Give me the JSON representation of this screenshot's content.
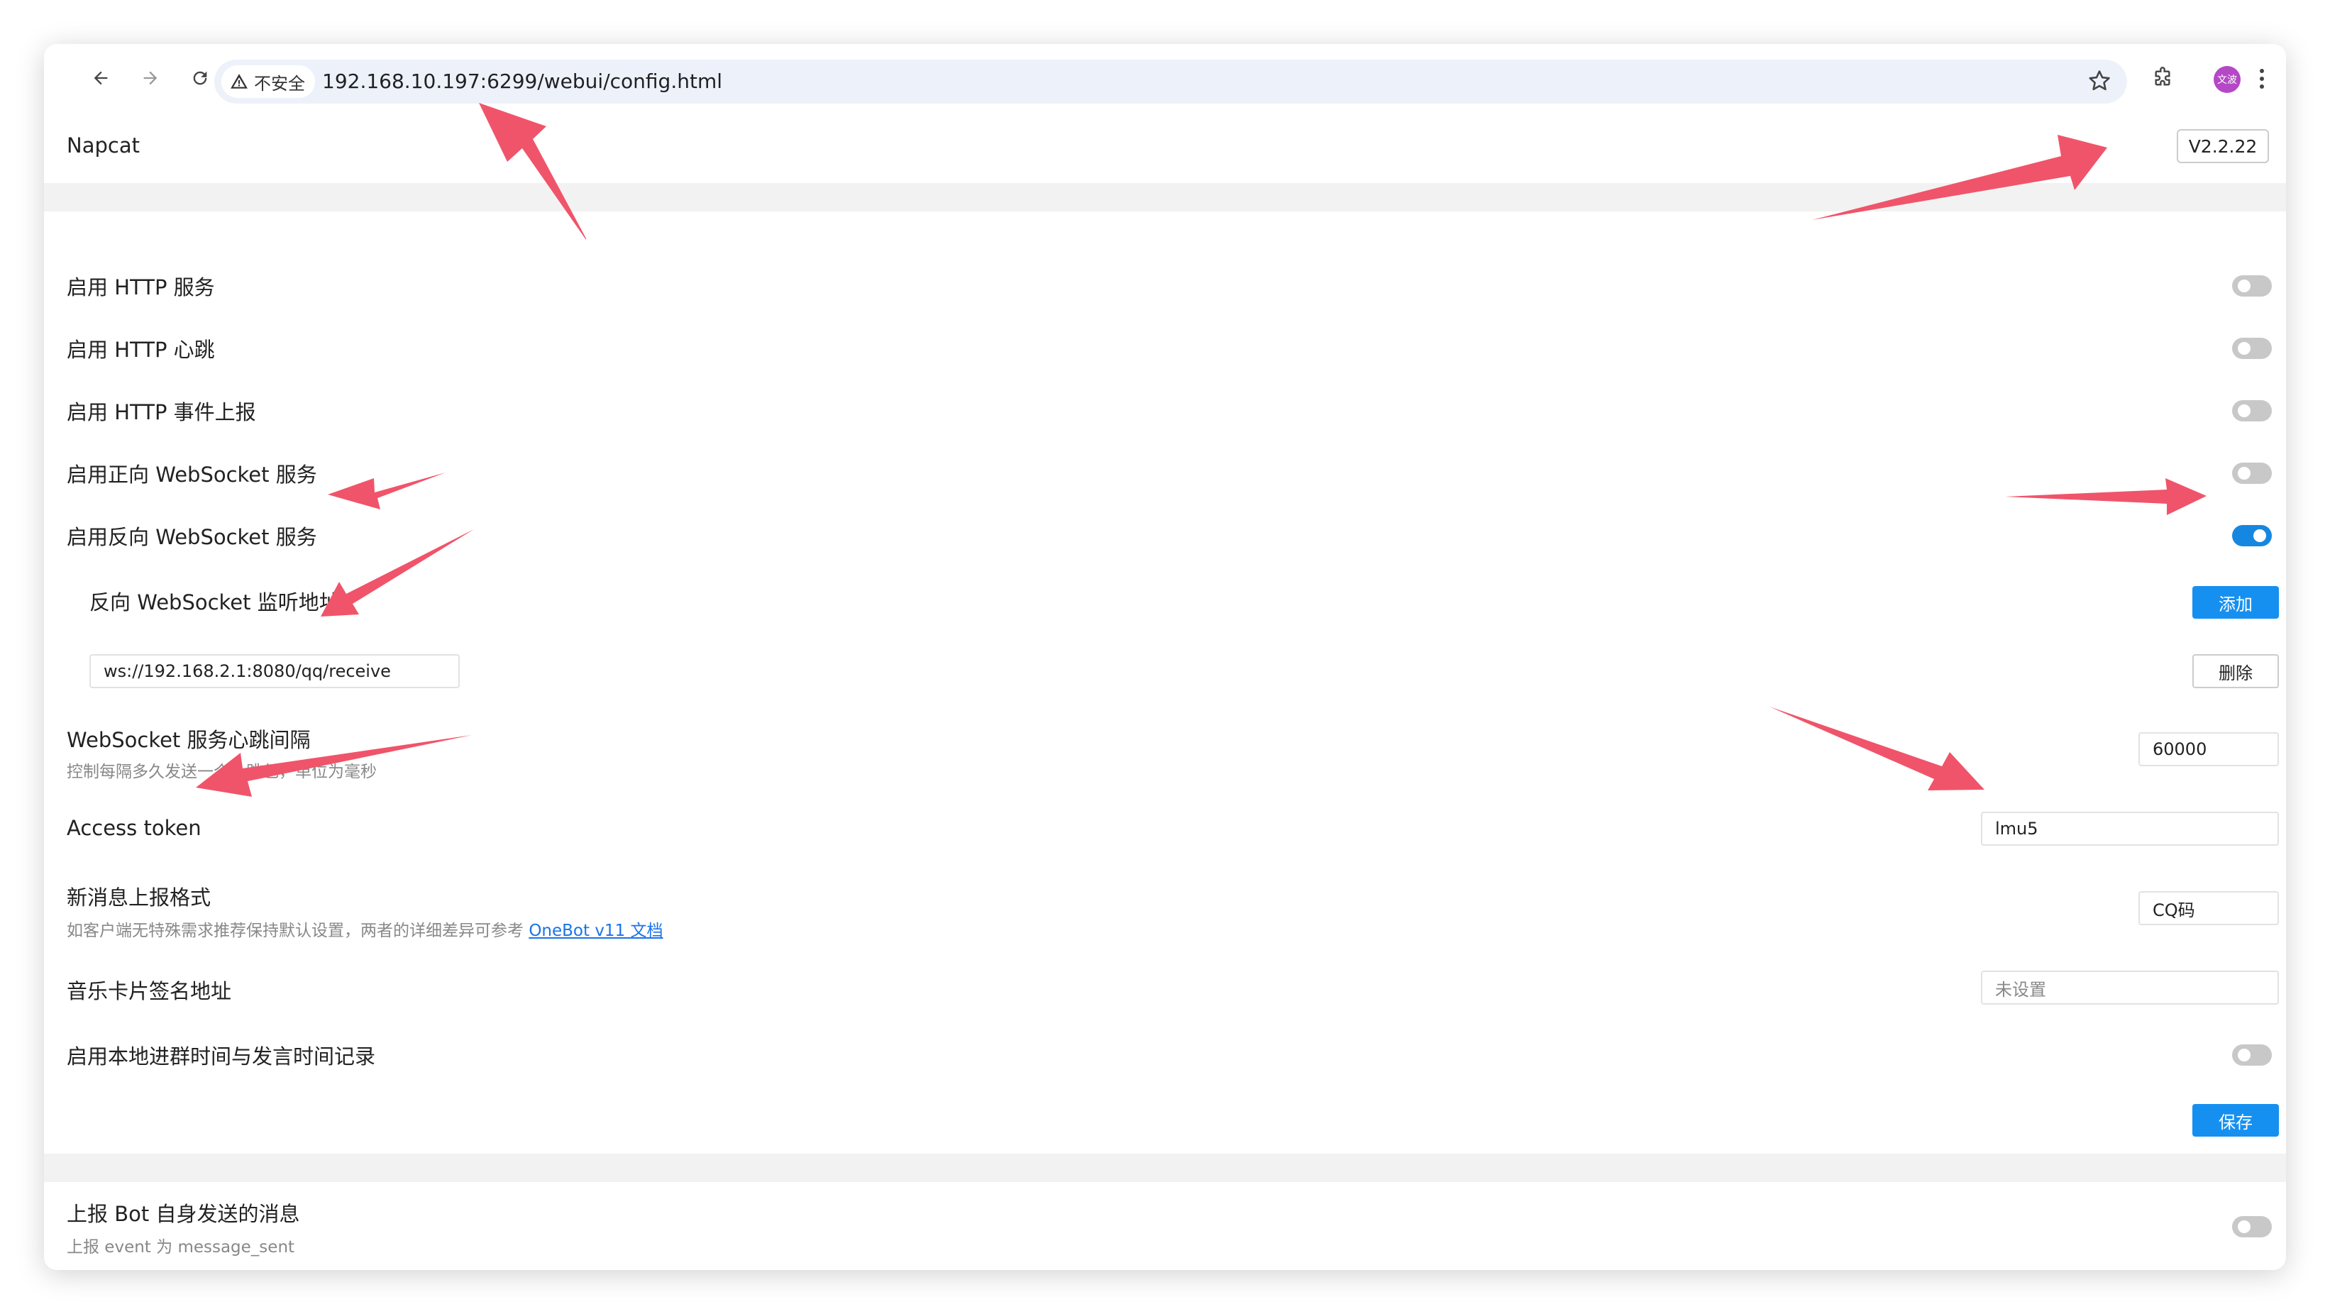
{
  "browser": {
    "security_label": "不安全",
    "url": "192.168.10.197:6299/webui/config.html",
    "profile_initials": "文波"
  },
  "header": {
    "title": "Napcat",
    "version": "V2.2.22"
  },
  "settings": {
    "http_service": "启用 HTTP 服务",
    "http_heartbeat": "启用 HTTP 心跳",
    "http_event_report": "启用 HTTP 事件上报",
    "forward_ws": "启用正向 WebSocket 服务",
    "reverse_ws": "启用反向 WebSocket 服务",
    "reverse_ws_address_label": "反向 WebSocket 监听地址",
    "add_button": "添加",
    "reverse_ws_address_value": "ws://192.168.2.1:8080/qq/receive",
    "delete_button": "删除",
    "ws_heartbeat_label": "WebSocket 服务心跳间隔",
    "ws_heartbeat_desc": "控制每隔多久发送一个心跳包，单位为毫秒",
    "ws_heartbeat_value": "60000",
    "access_token_label": "Access token",
    "access_token_value": "lmu5",
    "message_format_label": "新消息上报格式",
    "message_format_desc": "如客户端无特殊需求推荐保持默认设置，两者的详细差异可参考 ",
    "message_format_link": "OneBot v11 文档",
    "message_format_value": "CQ码",
    "music_sign_label": "音乐卡片签名地址",
    "music_sign_placeholder": "未设置",
    "local_record_label": "启用本地进群时间与发言时间记录",
    "save_button": "保存"
  },
  "toggles": {
    "http_service": false,
    "http_heartbeat": false,
    "http_event_report": false,
    "forward_ws": false,
    "reverse_ws": true,
    "local_record": false,
    "report_self": false
  },
  "report": {
    "label": "上报 Bot 自身发送的消息",
    "desc": "上报 event 为 message_sent"
  },
  "colors": {
    "accent": "#1690f0",
    "annotation_arrow": "#f0546a",
    "toggle_off": "#c8c8c8"
  }
}
